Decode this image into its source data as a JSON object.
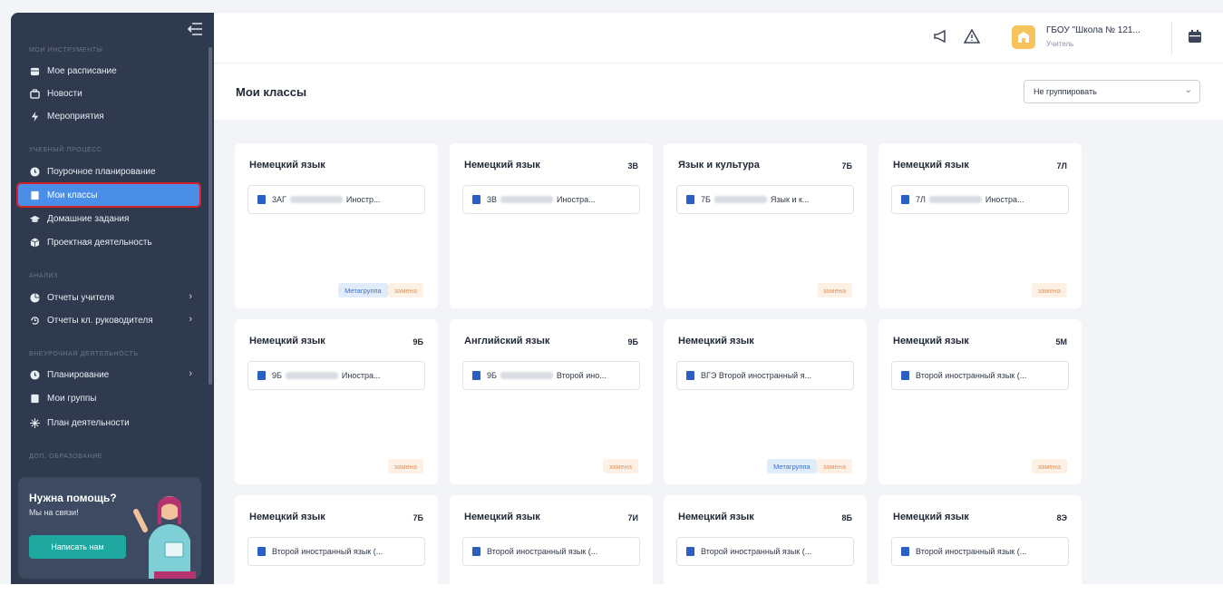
{
  "sidebar": {
    "sections": [
      "Мои инструменты",
      "Учебный процесс",
      "Анализ",
      "Внеурочная деятельность",
      "Доп. образование"
    ],
    "items": [
      {
        "label": "Мое расписание"
      },
      {
        "label": "Новости"
      },
      {
        "label": "Мероприятия"
      },
      {
        "label": "Поурочное планирование"
      },
      {
        "label": "Мои классы"
      },
      {
        "label": "Домашние задания"
      },
      {
        "label": "Проектная деятельность"
      },
      {
        "label": "Отчеты учителя"
      },
      {
        "label": "Отчеты кл. руководителя"
      },
      {
        "label": "Планирование"
      },
      {
        "label": "Мои группы"
      },
      {
        "label": "План деятельности"
      }
    ],
    "help": {
      "title": "Нужна помощь?",
      "subtitle": "Мы на связи!",
      "button": "Написать нам"
    }
  },
  "header": {
    "org_name": "ГБОУ \"Школа № 121...",
    "org_role": "Учитель"
  },
  "page": {
    "title": "Мои классы",
    "group_select": "Не группировать"
  },
  "cards": [
    {
      "subject": "Немецкий язык",
      "class": "",
      "chip_prefix": "3АГ",
      "chip_suffix": "Иностр...",
      "blurred": true,
      "badges": [
        "Метагруппа",
        "замена"
      ]
    },
    {
      "subject": "Немецкий язык",
      "class": "3В",
      "chip_prefix": "3В",
      "chip_suffix": "Иностра...",
      "blurred": true,
      "badges": []
    },
    {
      "subject": "Язык и культура",
      "class": "7Б",
      "chip_prefix": "7Б",
      "chip_suffix": "Язык и к...",
      "blurred": true,
      "badges": [
        "замена"
      ]
    },
    {
      "subject": "Немецкий язык",
      "class": "7Л",
      "chip_prefix": "7Л",
      "chip_suffix": "Иностра...",
      "blurred": true,
      "badges": [
        "замена"
      ]
    },
    {
      "subject": "Немецкий язык",
      "class": "9Б",
      "chip_prefix": "9Б",
      "chip_suffix": "Иностра...",
      "blurred": true,
      "badges": [
        "замена"
      ]
    },
    {
      "subject": "Английский язык",
      "class": "9Б",
      "chip_prefix": "9Б",
      "chip_suffix": "Второй ино...",
      "blurred": true,
      "badges": [
        "замена"
      ]
    },
    {
      "subject": "Немецкий язык",
      "class": "",
      "chip_prefix": "ВГЭ Второй иностранный я...",
      "chip_suffix": "",
      "blurred": false,
      "badges": [
        "Метагруппа",
        "замена"
      ]
    },
    {
      "subject": "Немецкий язык",
      "class": "5М",
      "chip_prefix": "Второй иностранный язык (...",
      "chip_suffix": "",
      "blurred": false,
      "badges": [
        "замена"
      ]
    },
    {
      "subject": "Немецкий язык",
      "class": "7Б",
      "chip_prefix": "Второй иностранный язык (...",
      "chip_suffix": "",
      "blurred": false,
      "badges": []
    },
    {
      "subject": "Немецкий язык",
      "class": "7И",
      "chip_prefix": "Второй иностранный язык (...",
      "chip_suffix": "",
      "blurred": false,
      "badges": []
    },
    {
      "subject": "Немецкий язык",
      "class": "8Б",
      "chip_prefix": "Второй иностранный язык (...",
      "chip_suffix": "",
      "blurred": false,
      "badges": []
    },
    {
      "subject": "Немецкий язык",
      "class": "8Э",
      "chip_prefix": "Второй иностранный язык (...",
      "chip_suffix": "",
      "blurred": false,
      "badges": []
    }
  ],
  "colors": {
    "sidebar_bg": "#2f3a4f",
    "active_item": "#4a8ee8",
    "highlight_outline": "#d6232a",
    "help_button": "#1fa8a0",
    "org_icon": "#f6c35d"
  }
}
